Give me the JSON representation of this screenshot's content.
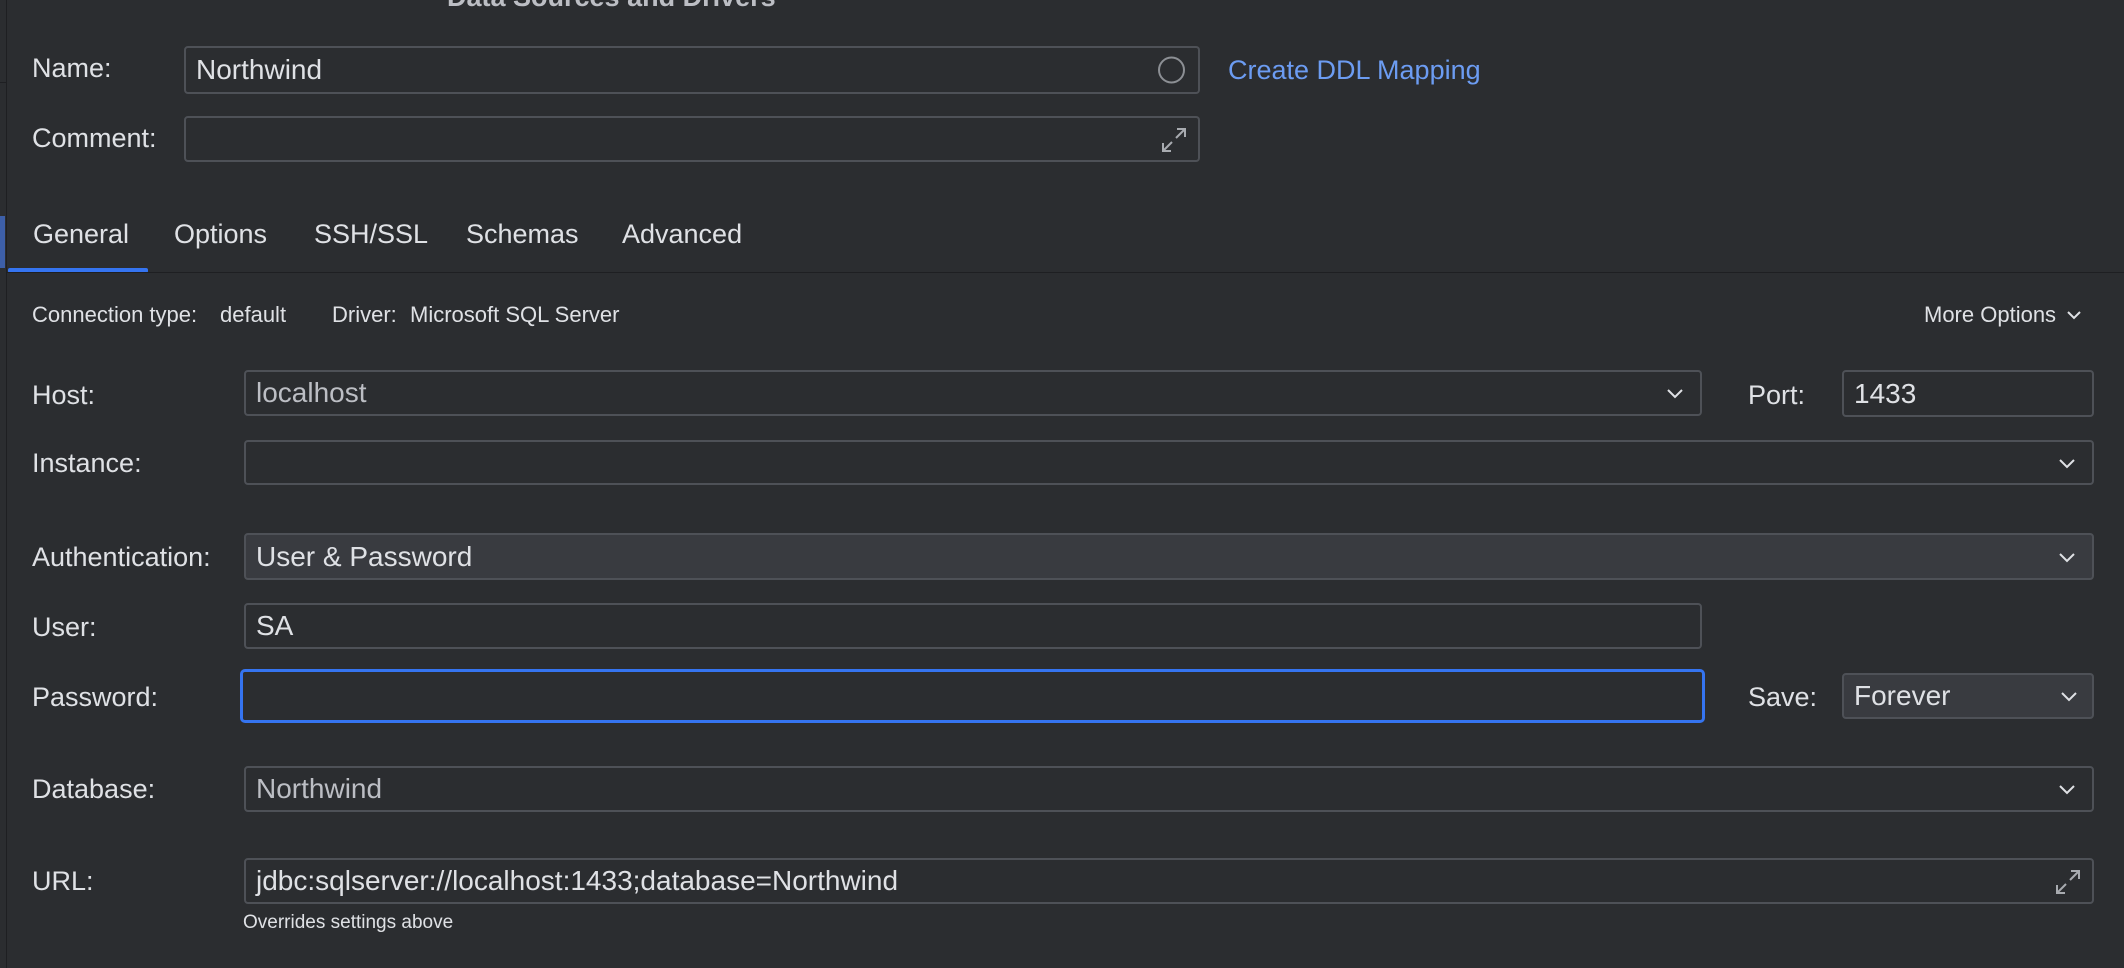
{
  "dialog": {
    "title": "Data Sources and Drivers"
  },
  "name": {
    "label": "Name:",
    "value": "Northwind",
    "ddl_link": "Create DDL Mapping"
  },
  "comment": {
    "label": "Comment:",
    "value": ""
  },
  "tabs": [
    {
      "label": "General",
      "active": true
    },
    {
      "label": "Options",
      "active": false
    },
    {
      "label": "SSH/SSL",
      "active": false
    },
    {
      "label": "Schemas",
      "active": false
    },
    {
      "label": "Advanced",
      "active": false
    }
  ],
  "connection": {
    "type_label": "Connection type:",
    "type_value": "default",
    "driver_label": "Driver:",
    "driver_value": "Microsoft SQL Server",
    "more_options": "More Options"
  },
  "host": {
    "label": "Host:",
    "value": "localhost"
  },
  "port": {
    "label": "Port:",
    "value": "1433"
  },
  "instance": {
    "label": "Instance:",
    "value": ""
  },
  "auth": {
    "label": "Authentication:",
    "value": "User & Password"
  },
  "user": {
    "label": "User:",
    "value": "SA"
  },
  "password": {
    "label": "Password:",
    "value": ""
  },
  "save": {
    "label": "Save:",
    "value": "Forever"
  },
  "database": {
    "label": "Database:",
    "value": "Northwind"
  },
  "url": {
    "label": "URL:",
    "value": "jdbc:sqlserver://localhost:1433;database=Northwind",
    "hint": "Overrides settings above"
  },
  "colors": {
    "accent": "#3574f0",
    "link": "#6c9cf2",
    "background": "#2b2d30",
    "border": "#4e5157"
  }
}
